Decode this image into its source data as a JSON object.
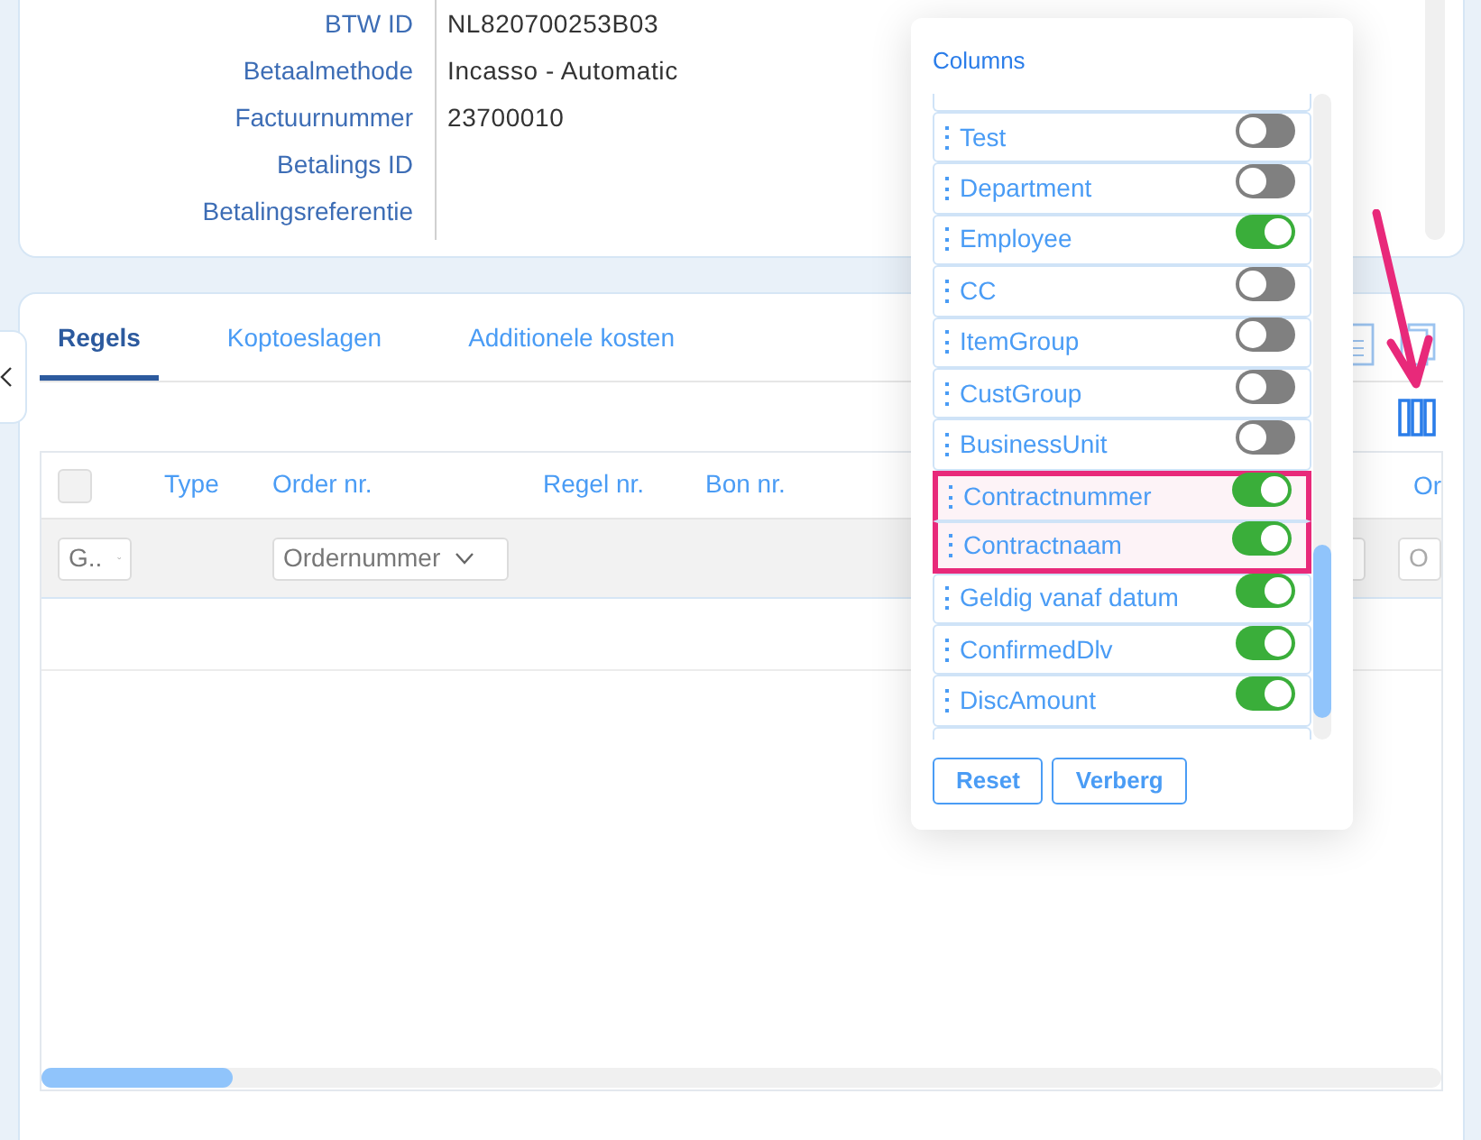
{
  "details": [
    {
      "label": "BTW ID",
      "value": "NL820700253B03"
    },
    {
      "label": "Betaalmethode",
      "value": "Incasso - Automatic"
    },
    {
      "label": "Factuurnummer",
      "value": "23700010"
    },
    {
      "label": "Betalings ID"
    },
    {
      "label": "Betalingsreferentie"
    }
  ],
  "tabs": [
    {
      "label": "Regels",
      "selected": true
    },
    {
      "label": "Koptoeslagen",
      "selected": false
    },
    {
      "label": "Additionele kosten",
      "selected": false
    }
  ],
  "table": {
    "select_all_checked": false,
    "columns": [
      "Type",
      "Order nr.",
      "Regel nr.",
      "Bon nr.",
      "Or"
    ],
    "filters": [
      {
        "kind": "select",
        "value": "G.."
      },
      {
        "kind": "select",
        "value": "Ordernummer"
      },
      {
        "kind": "input"
      },
      {
        "kind": "input",
        "placeholder": "O"
      }
    ]
  },
  "column_picker": {
    "title": "Columns",
    "items": [
      {
        "label": "Test",
        "on": false,
        "highlighted": false
      },
      {
        "label": "Department",
        "on": false,
        "highlighted": false
      },
      {
        "label": "Employee",
        "on": true,
        "highlighted": false
      },
      {
        "label": "CC",
        "on": false,
        "highlighted": false
      },
      {
        "label": "ItemGroup",
        "on": false,
        "highlighted": false
      },
      {
        "label": "CustGroup",
        "on": false,
        "highlighted": false
      },
      {
        "label": "BusinessUnit",
        "on": false,
        "highlighted": false
      },
      {
        "label": "Contractnummer",
        "on": true,
        "highlighted": true
      },
      {
        "label": "Contractnaam",
        "on": true,
        "highlighted": true
      },
      {
        "label": "Geldig vanaf datum",
        "on": true,
        "highlighted": false
      },
      {
        "label": "ConfirmedDlv",
        "on": true,
        "highlighted": false
      },
      {
        "label": "DiscAmount",
        "on": true,
        "highlighted": false
      }
    ],
    "buttons": [
      "Reset",
      "Verberg"
    ]
  }
}
